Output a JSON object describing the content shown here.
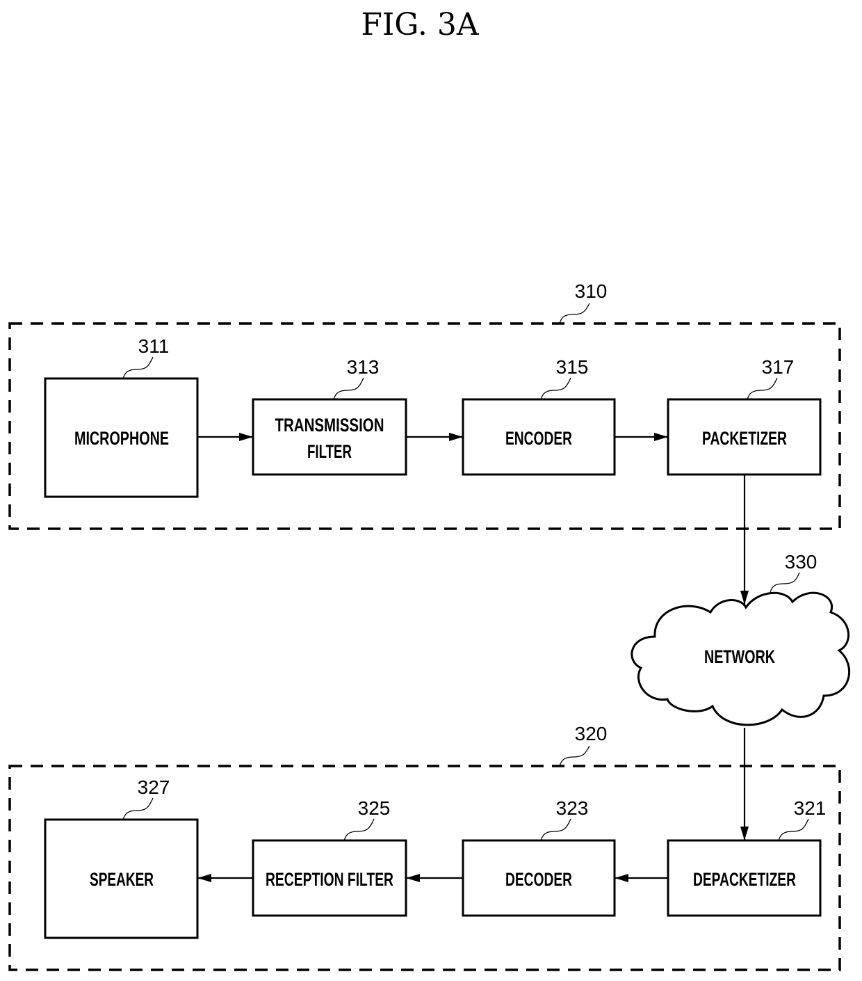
{
  "figure": {
    "title": "FIG. 3A"
  },
  "groups": [
    {
      "id": "transmitter",
      "ref": "310"
    },
    {
      "id": "receiver",
      "ref": "320"
    }
  ],
  "blocks": {
    "microphone": {
      "ref": "311",
      "lines": [
        "MICROPHONE"
      ]
    },
    "tx_filter": {
      "ref": "313",
      "lines": [
        "TRANSMISSION",
        "FILTER"
      ]
    },
    "encoder": {
      "ref": "315",
      "lines": [
        "ENCODER"
      ]
    },
    "packetizer": {
      "ref": "317",
      "lines": [
        "PACKETIZER"
      ]
    },
    "network": {
      "ref": "330",
      "lines": [
        "NETWORK"
      ]
    },
    "depacketizer": {
      "ref": "321",
      "lines": [
        "DEPACKETIZER"
      ]
    },
    "decoder": {
      "ref": "323",
      "lines": [
        "DECODER"
      ]
    },
    "rx_filter": {
      "ref": "325",
      "lines": [
        "RECEPTION FILTER"
      ]
    },
    "speaker": {
      "ref": "327",
      "lines": [
        "SPEAKER"
      ]
    }
  },
  "connections": [
    {
      "from": "microphone",
      "to": "tx_filter"
    },
    {
      "from": "tx_filter",
      "to": "encoder"
    },
    {
      "from": "encoder",
      "to": "packetizer"
    },
    {
      "from": "packetizer",
      "to": "network"
    },
    {
      "from": "network",
      "to": "depacketizer"
    },
    {
      "from": "depacketizer",
      "to": "decoder"
    },
    {
      "from": "decoder",
      "to": "rx_filter"
    },
    {
      "from": "rx_filter",
      "to": "speaker"
    }
  ]
}
